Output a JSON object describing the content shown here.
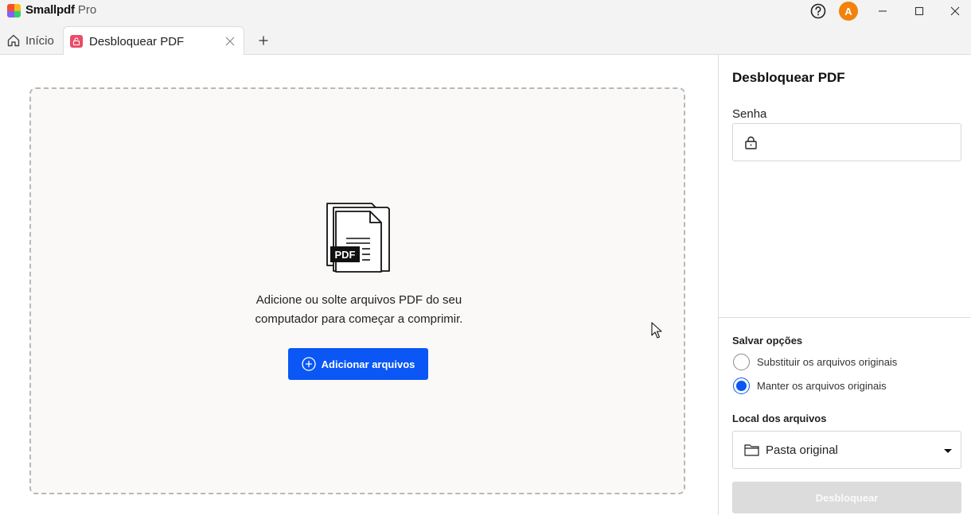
{
  "app": {
    "brand_name": "Smallpdf",
    "brand_suffix": "Pro",
    "avatar_initial": "A"
  },
  "tabs": {
    "home_label": "Início",
    "active_label": "Desbloquear PDF",
    "active_icon": "unlock-icon",
    "add_icon": "plus-icon"
  },
  "dropzone": {
    "illustration_label": "PDF",
    "instruction_line1": "Adicione ou solte arquivos PDF do seu",
    "instruction_line2": "computador para começar a comprimir.",
    "add_button_label": "Adicionar arquivos"
  },
  "panel": {
    "title": "Desbloquear PDF",
    "password_label": "Senha",
    "password_value": "",
    "save_options_title": "Salvar opções",
    "save_options": [
      {
        "label": "Substituir os arquivos originais",
        "checked": false
      },
      {
        "label": "Manter os arquivos originais",
        "checked": true
      }
    ],
    "location_title": "Local dos arquivos",
    "location_value": "Pasta original",
    "submit_label": "Desbloquear"
  },
  "colors": {
    "accent": "#0a57f5",
    "avatar": "#f2820c",
    "tab_icon": "#ea4c67",
    "disabled_button": "#dcdcdc"
  }
}
